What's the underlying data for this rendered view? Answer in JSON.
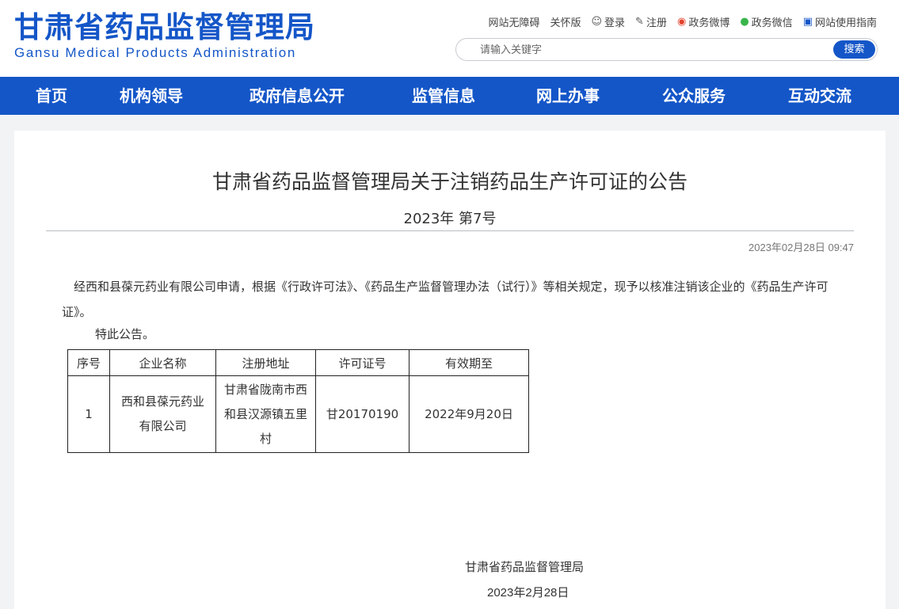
{
  "header": {
    "logo_cn": "甘肃省药品监督管理局",
    "logo_en": "Gansu Medical Products Administration",
    "links": [
      {
        "label": "网站无障碍",
        "icon": ""
      },
      {
        "label": "关怀版",
        "icon": ""
      },
      {
        "label": "登录",
        "icon": "user-icon"
      },
      {
        "label": "注册",
        "icon": "pencil-icon"
      },
      {
        "label": "政务微博",
        "icon": "weibo-icon"
      },
      {
        "label": "政务微信",
        "icon": "wechat-icon"
      },
      {
        "label": "网站使用指南",
        "icon": "book-icon"
      }
    ],
    "search_placeholder": "请输入关键字",
    "search_button": "搜索"
  },
  "nav": [
    "首页",
    "机构领导",
    "政府信息公开",
    "监管信息",
    "网上办事",
    "公众服务",
    "互动交流"
  ],
  "article": {
    "title": "甘肃省药品监督管理局关于注销药品生产许可证的公告",
    "number": "2023年 第7号",
    "date": "2023年02月28日 09:47",
    "body": "经西和县葆元药业有限公司申请，根据《行政许可法》、《药品生产监督管理办法（试行）》等相关规定，现予以核准注销该企业的《药品生产许可证》。",
    "notice": "特此公告。",
    "table": {
      "headers": [
        "序号",
        "企业名称",
        "注册地址",
        "许可证号",
        "有效期至"
      ],
      "rows": [
        [
          "1",
          "西和县葆元药业有限公司",
          "甘肃省陇南市西和县汉源镇五里村",
          "甘20170190",
          "2022年9月20日"
        ]
      ]
    },
    "sign_org": "甘肃省药品监督管理局",
    "sign_date": "2023年2月28日"
  },
  "colors": {
    "brand": "#1456c8",
    "background": "#f2f3f5"
  }
}
